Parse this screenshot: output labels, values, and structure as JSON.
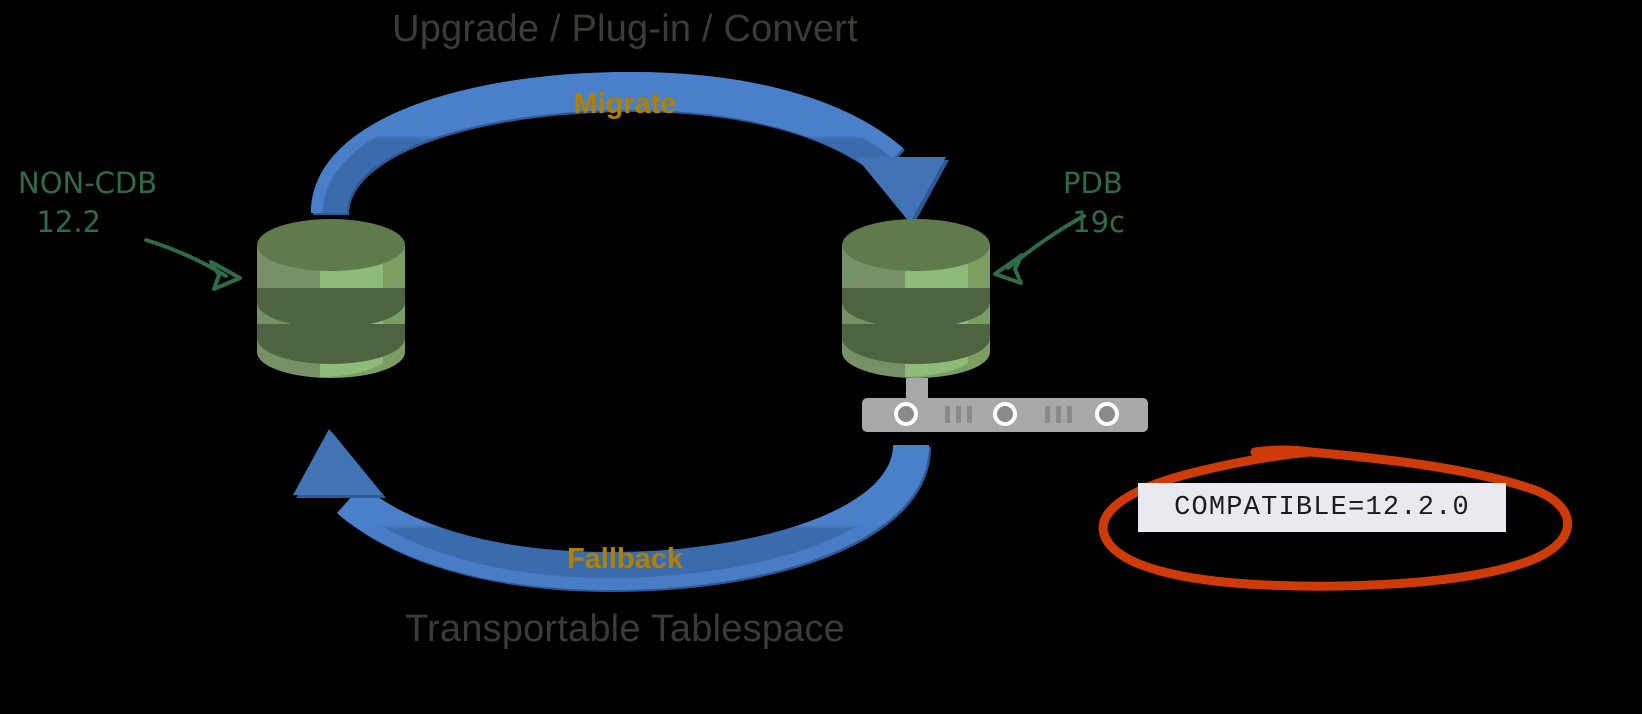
{
  "diagram": {
    "background_color": "#000000",
    "title_top": "Upgrade / Plug-in / Convert",
    "title_bottom": "Transportable Tablespace",
    "flow_labels": {
      "forward": "Migrate",
      "backward": "Fallback"
    },
    "annotations": {
      "source": "NON-CDB\n  12.2",
      "source_line1": "NON-CDB",
      "source_line2": "12.2",
      "target": "PDB\n 19c",
      "target_line1": "PDB",
      "target_line2": "19c"
    },
    "callout": {
      "text": "COMPATIBLE=12.2.0",
      "box_fill": "#e8eaf0",
      "circle_color": "#cf3a09"
    },
    "nodes": [
      {
        "id": "source-database",
        "label": "NON-CDB 12.2",
        "shape": "cylinder"
      },
      {
        "id": "target-database",
        "label": "PDB 19c",
        "shape": "cylinder"
      }
    ],
    "server": {
      "id": "server-rack",
      "ports": 3,
      "vent_groups": 2
    },
    "colors": {
      "title_text": "#3b3b38",
      "flow_label_text": "#b08000",
      "annotation_green": "#2f6b46",
      "arrow_blue": "#3a6bad",
      "arrow_blue_light": "#4a7fc9",
      "arrow_blue_dark": "#2c5a96",
      "db_body": "#7c9e63",
      "db_highlight": "#8fbb7a",
      "db_top": "#5f7a4c",
      "db_band": "#4e6440",
      "server_gray": "#a8a8a8"
    }
  }
}
